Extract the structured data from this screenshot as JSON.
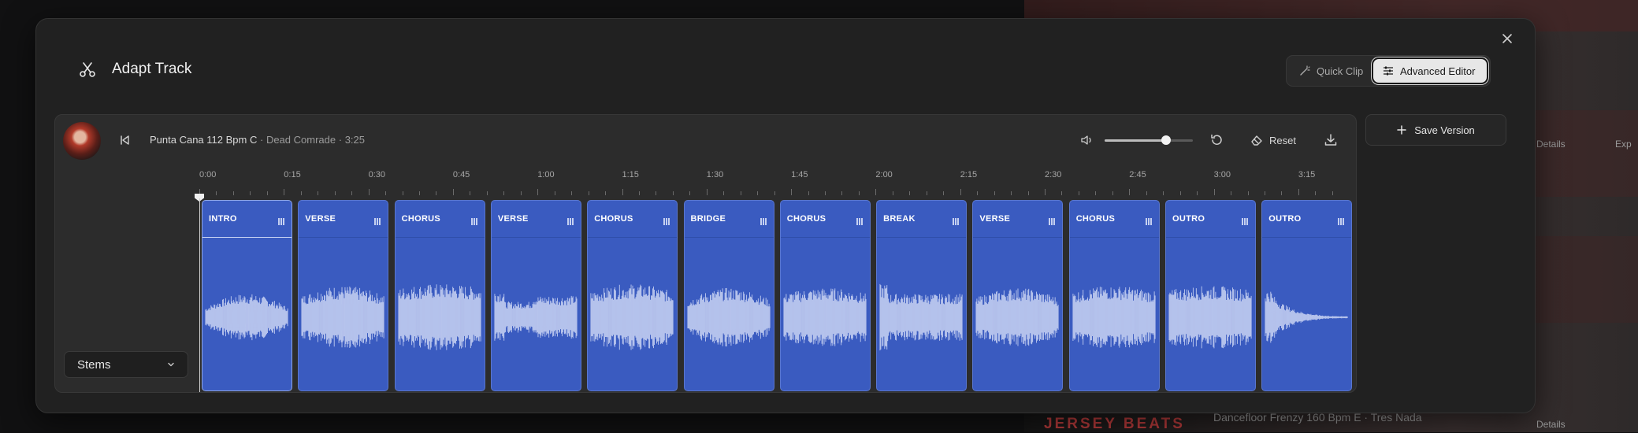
{
  "background": {
    "track_title": "Dancefloor Frenzy 160 Bpm E · Tres Nada",
    "brand_text": "JERSEY BEATS",
    "details_label_1": "Details",
    "details_label_2": "Details",
    "export_label": "Exp"
  },
  "modal": {
    "title": "Adapt Track",
    "close_icon": "close-icon",
    "modes": {
      "quick_label": "Quick Clip",
      "advanced_label": "Advanced Editor",
      "selected": "advanced"
    },
    "save_version_label": "Save Version"
  },
  "player": {
    "track_name": "Punta Cana 112 Bpm C",
    "artist": "Dead Comrade",
    "duration": "3:25",
    "separator": "·",
    "volume": 0.7,
    "reset_label": "Reset"
  },
  "timeline": {
    "labels": [
      "0:00",
      "0:15",
      "0:30",
      "0:45",
      "1:00",
      "1:15",
      "1:30",
      "1:45",
      "2:00",
      "2:15",
      "2:30",
      "2:45",
      "3:00",
      "3:15"
    ],
    "playhead_time": "0:00"
  },
  "segments": [
    {
      "label": "INTRO",
      "selected": true
    },
    {
      "label": "VERSE"
    },
    {
      "label": "CHORUS"
    },
    {
      "label": "VERSE"
    },
    {
      "label": "CHORUS"
    },
    {
      "label": "BRIDGE"
    },
    {
      "label": "CHORUS"
    },
    {
      "label": "BREAK"
    },
    {
      "label": "VERSE"
    },
    {
      "label": "CHORUS"
    },
    {
      "label": "OUTRO"
    },
    {
      "label": "OUTRO"
    }
  ],
  "stems": {
    "label": "Stems"
  },
  "colors": {
    "segment_fill": "#3a5bc0",
    "waveform": "#c2cdf0",
    "modal_bg": "#212121"
  }
}
